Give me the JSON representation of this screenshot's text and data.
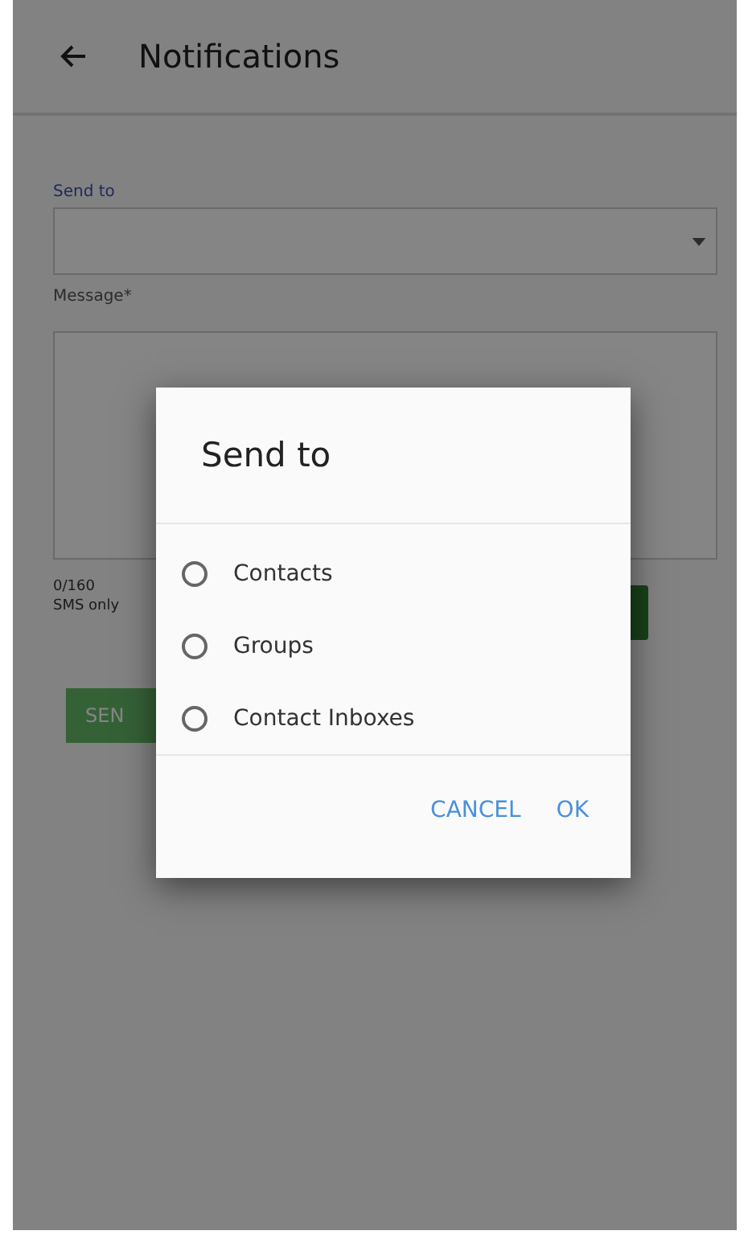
{
  "app_bar": {
    "title": "Notifications"
  },
  "form": {
    "send_to_label": "Send to",
    "message_label": "Message*",
    "counter": "0/160",
    "note": "SMS only",
    "send_button": "SEN"
  },
  "dialog": {
    "title": "Send to",
    "options": [
      {
        "label": "Contacts",
        "selected": false
      },
      {
        "label": "Groups",
        "selected": false
      },
      {
        "label": "Contact Inboxes",
        "selected": false
      }
    ],
    "buttons": [
      "CANCEL",
      "OK"
    ]
  }
}
